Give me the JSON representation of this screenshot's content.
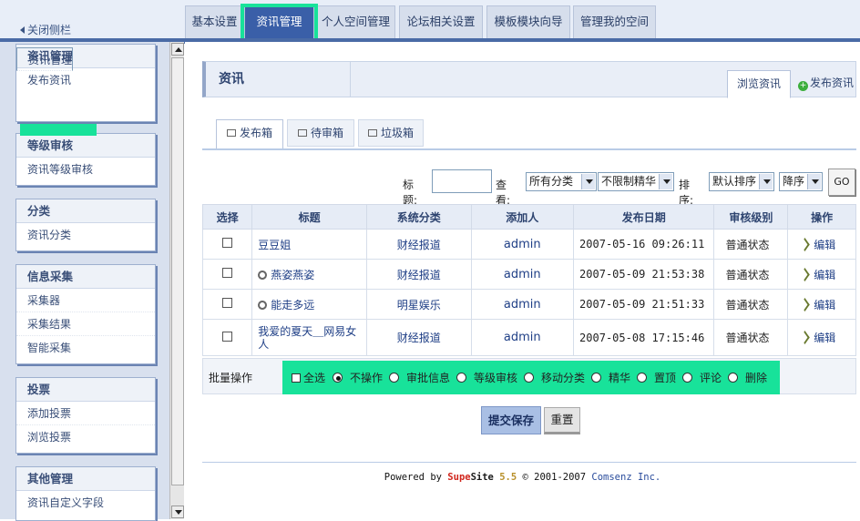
{
  "topbar": {
    "toggle_label": "关闭侧栏",
    "tabs": [
      "基本设置",
      "资讯管理",
      "个人空间管理",
      "论坛相关设置",
      "模板模块向导",
      "管理我的空间"
    ]
  },
  "sidebar": {
    "sections": [
      {
        "title": "资讯管理",
        "items": [
          "资讯管理",
          "发布资讯"
        ]
      },
      {
        "title": "等级审核",
        "items": [
          "资讯等级审核"
        ]
      },
      {
        "title": "分类",
        "items": [
          "资讯分类"
        ]
      },
      {
        "title": "信息采集",
        "items": [
          "采集器",
          "采集结果",
          "智能采集"
        ]
      },
      {
        "title": "投票",
        "items": [
          "添加投票",
          "浏览投票"
        ]
      },
      {
        "title": "其他管理",
        "items": [
          "资讯自定义字段"
        ]
      }
    ]
  },
  "content": {
    "title": "资讯",
    "tab_browse": "浏览资讯",
    "tab_publish": "发布资讯",
    "subtabs": [
      "发布箱",
      "待审箱",
      "垃圾箱"
    ]
  },
  "filter": {
    "title_label": "标题:",
    "view_label": "查看:",
    "category_value": "所有分类",
    "digest_value": "不限制精华",
    "sort_label": "排序:",
    "sort_value": "默认排序",
    "order_value": "降序",
    "go_label": "GO"
  },
  "table": {
    "headers": [
      "选择",
      "标题",
      "系统分类",
      "添加人",
      "发布日期",
      "审核级别",
      "操作"
    ],
    "rows": [
      {
        "title": "豆豆姐",
        "category": "财经报道",
        "author": "admin",
        "date": "2007-05-16 09:26:11",
        "status": "普通状态",
        "action": "编辑"
      },
      {
        "title": "燕姿燕姿",
        "category": "财经报道",
        "author": "admin",
        "date": "2007-05-09 21:53:38",
        "status": "普通状态",
        "action": "编辑"
      },
      {
        "title": "能走多远",
        "category": "明星娱乐",
        "author": "admin",
        "date": "2007-05-09 21:51:33",
        "status": "普通状态",
        "action": "编辑"
      },
      {
        "title": "我爱的夏天＿网易女人",
        "category": "财经报道",
        "author": "admin",
        "date": "2007-05-08 17:15:46",
        "status": "普通状态",
        "action": "编辑"
      }
    ]
  },
  "batch": {
    "label": "批量操作",
    "select_all": "全选",
    "options": [
      "不操作",
      "审批信息",
      "等级审核",
      "移动分类",
      "精华",
      "置顶",
      "评论",
      "删除"
    ]
  },
  "buttons": {
    "submit": "提交保存",
    "reset": "重置"
  },
  "footer": {
    "powered_by": "Powered by",
    "brand_a": "Supe",
    "brand_b": "Site",
    "version": "5.5",
    "copyright": "© 2001-2007",
    "company": "Comsenz Inc."
  }
}
